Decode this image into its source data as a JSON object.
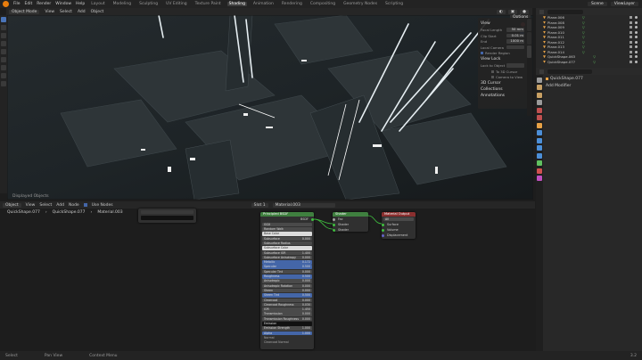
{
  "topbar": {
    "menus": [
      "File",
      "Edit",
      "Render",
      "Window",
      "Help"
    ],
    "workspaces": [
      "Layout",
      "Modeling",
      "Sculpting",
      "UV Editing",
      "Texture Paint",
      "Shading",
      "Animation",
      "Rendering",
      "Compositing",
      "Geometry Nodes",
      "Scripting"
    ],
    "active_workspace": "Shading",
    "scene": "Scene",
    "view_layer": "ViewLayer"
  },
  "viewport": {
    "mode": "Object Mode",
    "menus": [
      "View",
      "Select",
      "Add",
      "Object"
    ],
    "options": "Options",
    "info": "Displayed Objects",
    "npanel": {
      "view_title": "View",
      "focal_label": "Focal Length",
      "focal_value": "50 mm",
      "clip_start_label": "Clip Start",
      "clip_start_value": "0.01 m",
      "clip_end_label": "End",
      "clip_end_value": "1000 m",
      "local_camera_label": "Local Camera",
      "render_region": "Render Region",
      "view_lock": "View Lock",
      "lock_label": "Lock to Object",
      "lock_cursor": "To 3D Cursor",
      "lock_camera": "Camera to View",
      "cursor_section": "3D Cursor",
      "collections_section": "Collections",
      "annotations_section": "Annotations"
    },
    "tabs": [
      "Item",
      "Tool",
      "View"
    ]
  },
  "node_editor": {
    "mode": "Object",
    "menus": [
      "View",
      "Select",
      "Add",
      "Node"
    ],
    "use_nodes": "Use Nodes",
    "slot": "Slot 1",
    "material": "Material.003",
    "breadcrumb": [
      "QuickShape.077",
      "QuickShape.077",
      "Material.003"
    ],
    "bsdf": {
      "title": "Principled BSDF",
      "output": "BSDF",
      "distribution": "GGX",
      "subsurface_method": "Random Walk",
      "rows": [
        {
          "label": "Base Color",
          "value": "",
          "style": "white"
        },
        {
          "label": "Subsurface",
          "value": "0.000",
          "style": "gray"
        },
        {
          "label": "Subsurface Radius",
          "value": "",
          "style": "gray"
        },
        {
          "label": "Subsurface Color",
          "value": "",
          "style": "white"
        },
        {
          "label": "Subsurface IOR",
          "value": "1.400",
          "style": "gray"
        },
        {
          "label": "Subsurface Anisotropy",
          "value": "0.000",
          "style": "gray"
        },
        {
          "label": "Metallic",
          "value": "0.172",
          "style": "blue"
        },
        {
          "label": "Specular",
          "value": "0.500",
          "style": "blue"
        },
        {
          "label": "Specular Tint",
          "value": "0.000",
          "style": "gray"
        },
        {
          "label": "Roughness",
          "value": "0.500",
          "style": "blue"
        },
        {
          "label": "Anisotropic",
          "value": "0.000",
          "style": "gray"
        },
        {
          "label": "Anisotropic Rotation",
          "value": "0.000",
          "style": "gray"
        },
        {
          "label": "Sheen",
          "value": "0.000",
          "style": "gray"
        },
        {
          "label": "Sheen Tint",
          "value": "0.500",
          "style": "blue"
        },
        {
          "label": "Clearcoat",
          "value": "0.000",
          "style": "gray"
        },
        {
          "label": "Clearcoat Roughness",
          "value": "0.030",
          "style": "gray"
        },
        {
          "label": "IOR",
          "value": "1.450",
          "style": "gray"
        },
        {
          "label": "Transmission",
          "value": "0.000",
          "style": "gray"
        },
        {
          "label": "Transmission Roughness",
          "value": "0.000",
          "style": "gray"
        },
        {
          "label": "Emission",
          "value": "",
          "style": "dark"
        },
        {
          "label": "Emission Strength",
          "value": "1.000",
          "style": "gray"
        },
        {
          "label": "Alpha",
          "value": "1.000",
          "style": "blue"
        },
        {
          "label": "Normal",
          "value": "",
          "style": "plain"
        },
        {
          "label": "Clearcoat Normal",
          "value": "",
          "style": "plain"
        }
      ]
    },
    "mix_node": {
      "title": "Shader",
      "sockets": [
        "Fac",
        "Shader",
        "Shader"
      ]
    },
    "output_node": {
      "title": "Material Output",
      "target": "All",
      "sockets": [
        "Surface",
        "Volume",
        "Displacement"
      ]
    }
  },
  "outliner": {
    "items": [
      "Plane.006",
      "Plane.008",
      "Plane.009",
      "Plane.010",
      "Plane.011",
      "Plane.012",
      "Plane.013",
      "Plane.014",
      "QuickShape.063",
      "QuickShape.077"
    ]
  },
  "properties": {
    "object": "QuickShape.077",
    "section": "Add Modifier"
  },
  "statusbar": {
    "left": "Select",
    "middle": "Pan View",
    "right": "Context Menu",
    "version": "3.2"
  },
  "colors": {
    "accent_blue": "#4466a8",
    "shader_green": "#3f7f3f",
    "output_red": "#8a2f2f",
    "shader_socket": "#3fbf3f",
    "color_socket": "#c7c729"
  }
}
